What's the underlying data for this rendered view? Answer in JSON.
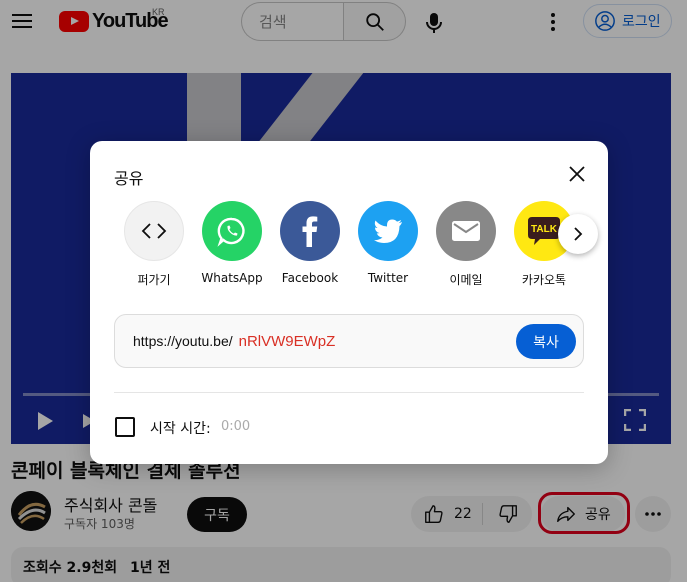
{
  "header": {
    "logo_text": "YouTube",
    "region": "KR",
    "search_placeholder": "검색",
    "login_label": "로그인"
  },
  "video": {
    "title": "콘페이 블록체인 결제 솔루션",
    "channel_name": "주식회사 콘돌",
    "subscribers": "구독자 103명",
    "subscribe_label": "구독",
    "like_count": "22",
    "share_label": "공유",
    "views": "조회수 2.9천회",
    "age": "1년 전"
  },
  "dialog": {
    "title": "공유",
    "targets": [
      {
        "label": "퍼가기",
        "icon": "embed-icon",
        "color": "#f2f2f2"
      },
      {
        "label": "WhatsApp",
        "icon": "whatsapp-icon",
        "color": "#25d366"
      },
      {
        "label": "Facebook",
        "icon": "facebook-icon",
        "color": "#3b5998"
      },
      {
        "label": "Twitter",
        "icon": "twitter-icon",
        "color": "#1da1f2"
      },
      {
        "label": "이메일",
        "icon": "email-icon",
        "color": "#888888"
      },
      {
        "label": "카카오톡",
        "icon": "kakaotalk-icon",
        "color": "#ffe812"
      }
    ],
    "url_base": "https://youtu.be/",
    "url_id": "nRlVW9EWpZ",
    "copy_label": "복사",
    "start_time_label": "시작 시간:",
    "start_time_value": "0:00"
  },
  "colors": {
    "brand_red": "#ff0000",
    "link_blue": "#065fd4",
    "highlight_red": "#e1001c"
  }
}
